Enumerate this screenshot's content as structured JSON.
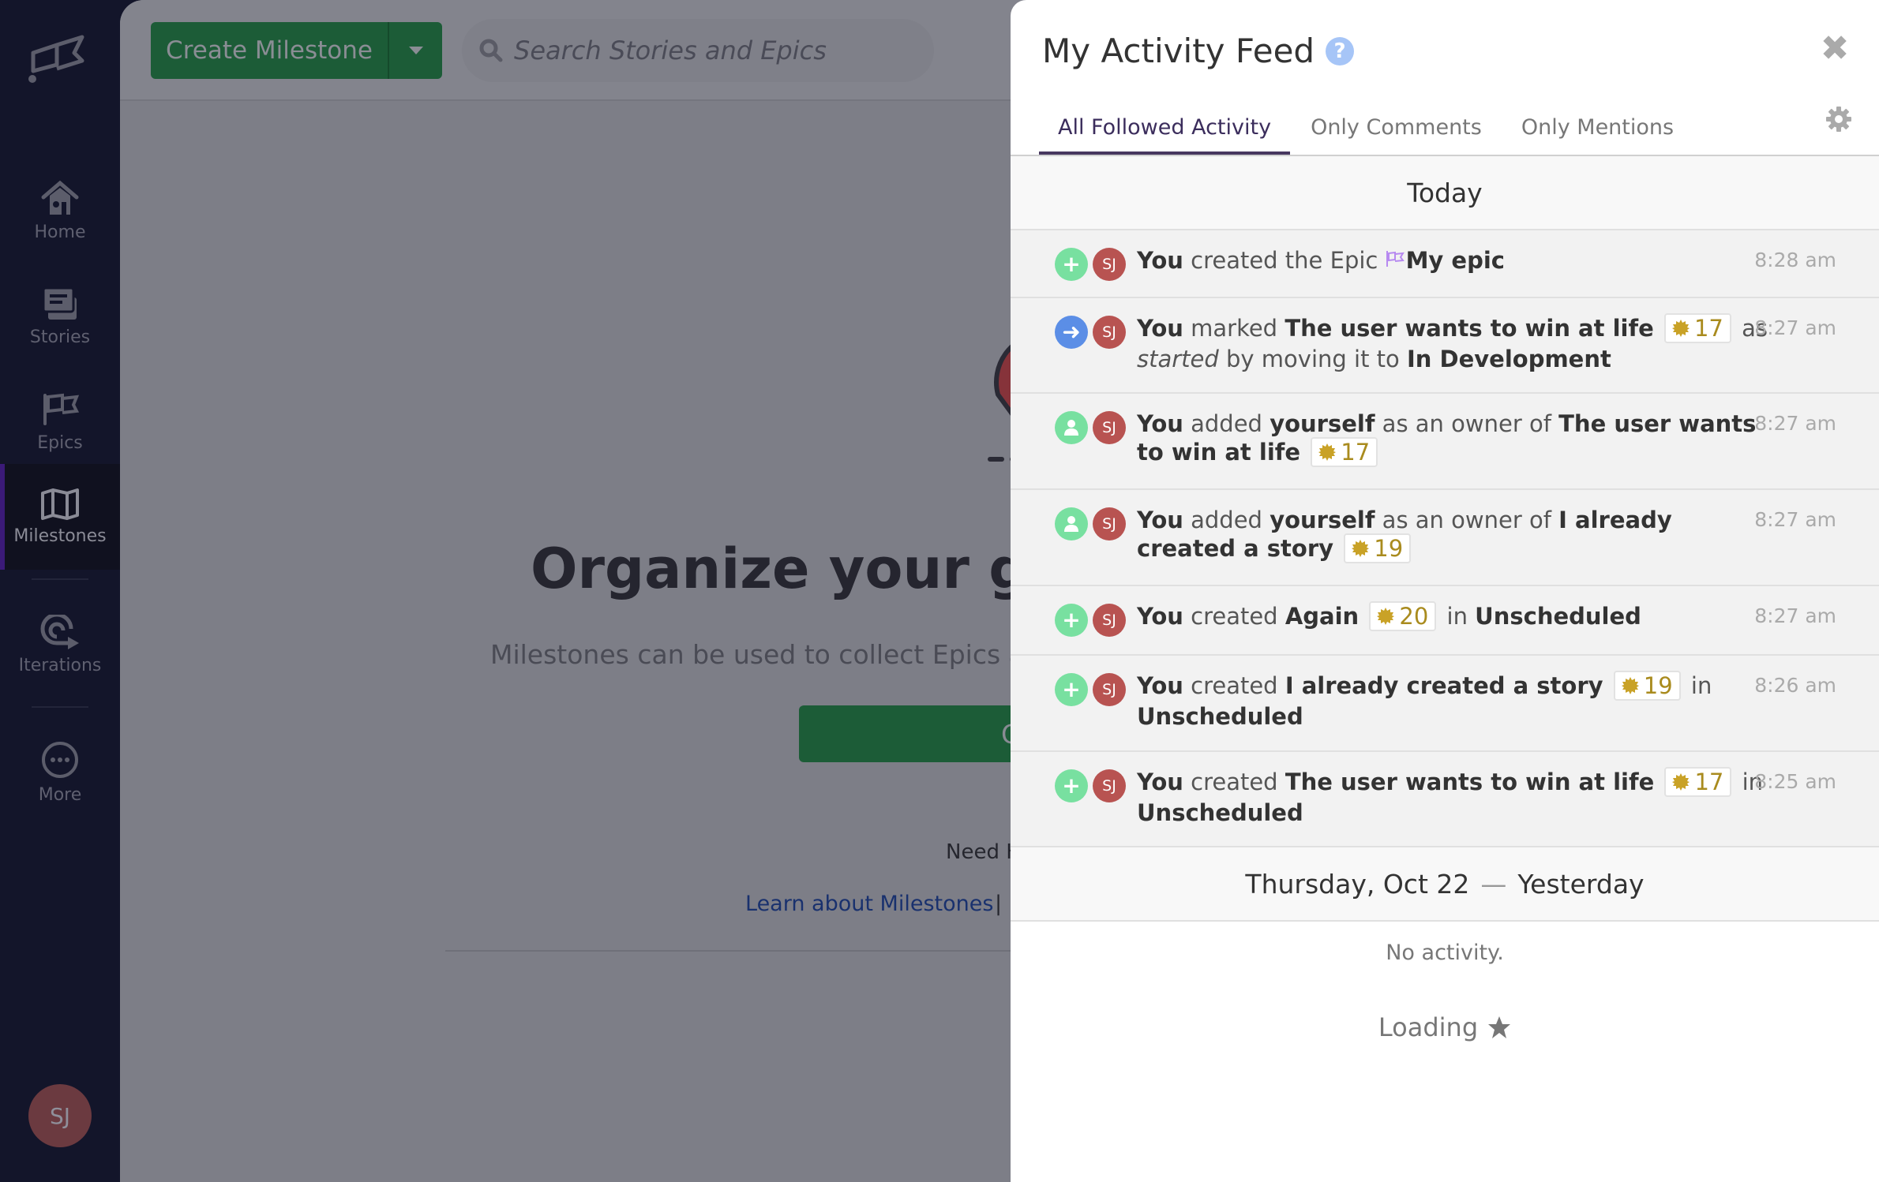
{
  "sidebar": {
    "items": [
      {
        "label": "Home",
        "icon": "home-icon"
      },
      {
        "label": "Stories",
        "icon": "stories-icon"
      },
      {
        "label": "Epics",
        "icon": "epics-flag-icon"
      },
      {
        "label": "Milestones",
        "icon": "map-icon",
        "active": true
      },
      {
        "label": "Iterations",
        "icon": "iterations-icon"
      },
      {
        "label": "More",
        "icon": "more-icon"
      }
    ],
    "user_initials": "SJ"
  },
  "toolbar": {
    "create_label": "Create Milestone",
    "search_placeholder": "Search Stories and Epics"
  },
  "empty_state": {
    "headline": "Organize your goals",
    "subline": "Milestones can be used to collect Epics and",
    "cta_label": "Create a Milestone",
    "need_help": "Need Help?",
    "learn_link": "Learn about Milestones",
    "separator": "|"
  },
  "panel": {
    "title": "My Activity Feed",
    "help_glyph": "?",
    "close_glyph": "✖",
    "tabs": [
      {
        "label": "All Followed Activity",
        "active": true
      },
      {
        "label": "Only Comments"
      },
      {
        "label": "Only Mentions"
      }
    ],
    "today_label": "Today",
    "yesterday_date": "Thursday, Oct 22",
    "yesterday_dash": "—",
    "yesterday_label": "Yesterday",
    "no_activity": "No activity.",
    "loading": "Loading"
  },
  "colors": {
    "create": "#78e0a0",
    "move": "#5b8ee6",
    "owner": "#78e0a0",
    "avatar": "#b85351",
    "estimate": "#c9a227",
    "epic": "#b78af0"
  },
  "activity": [
    {
      "type": "create",
      "avatar": "SJ",
      "time": "8:28 am",
      "parts": {
        "actor": "You",
        "verb": "created the Epic",
        "object": "My epic"
      }
    },
    {
      "type": "move",
      "avatar": "SJ",
      "time": "8:27 am",
      "parts": {
        "actor": "You",
        "verb": "marked",
        "object": "The user wants to win at life",
        "estimate": "17",
        "tail1": "as",
        "state": "started",
        "tail2": "by moving it to",
        "target": "In Development"
      }
    },
    {
      "type": "owner",
      "avatar": "SJ",
      "time": "8:27 am",
      "parts": {
        "actor": "You",
        "verb": "added",
        "who": "yourself",
        "tail1": "as an owner of",
        "object": "The user wants to win at life",
        "estimate": "17"
      }
    },
    {
      "type": "owner",
      "avatar": "SJ",
      "time": "8:27 am",
      "parts": {
        "actor": "You",
        "verb": "added",
        "who": "yourself",
        "tail1": "as an owner of",
        "object": "I already created a story",
        "estimate": "19"
      }
    },
    {
      "type": "create",
      "avatar": "SJ",
      "time": "8:27 am",
      "parts": {
        "actor": "You",
        "verb": "created",
        "object": "Again",
        "estimate": "20",
        "tail1": "in",
        "target": "Unscheduled"
      }
    },
    {
      "type": "create",
      "avatar": "SJ",
      "time": "8:26 am",
      "parts": {
        "actor": "You",
        "verb": "created",
        "object": "I already created a story",
        "estimate": "19",
        "tail1": "in",
        "target": "Unscheduled"
      }
    },
    {
      "type": "create",
      "avatar": "SJ",
      "time": "8:25 am",
      "parts": {
        "actor": "You",
        "verb": "created",
        "object": "The user wants to win at life",
        "estimate": "17",
        "tail1": "in",
        "target": "Unscheduled"
      }
    }
  ]
}
